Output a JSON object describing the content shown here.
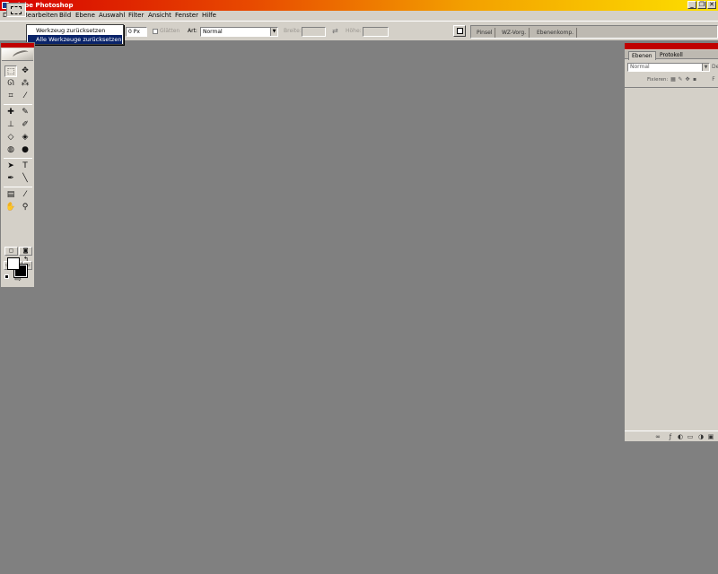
{
  "app": {
    "title": "Adobe Photoshop",
    "window_buttons": [
      "_",
      "❐",
      "✕"
    ]
  },
  "menu": {
    "items": [
      "Datei",
      "Bearbeiten",
      "Bild",
      "Ebene",
      "Auswahl",
      "Filter",
      "Ansicht",
      "Fenster",
      "Hilfe"
    ]
  },
  "options": {
    "feather_value": "0 Px",
    "antialias_label": "Glätten",
    "style_label": "Art:",
    "style_value": "Normal",
    "width_label": "Breite:",
    "height_label": "Höhe:"
  },
  "palette_well": {
    "tabs": [
      "Pinsel",
      "WZ-Vorg.",
      "Ebenenkomp."
    ]
  },
  "dropdown": {
    "items": [
      {
        "label": "Werkzeug zurücksetzen",
        "selected": false
      },
      {
        "label": "Alle Werkzeuge zurücksetzen",
        "selected": true
      }
    ]
  },
  "layers_palette": {
    "tabs": [
      "Ebenen",
      "Protokoll"
    ],
    "blend_mode": "Normal",
    "opacity_stub": "De",
    "lock_label": "Fixieren:",
    "fill_stub": "F"
  },
  "colors": {
    "canvas_bg": "#808080",
    "chrome": "#d4d0c8",
    "palette_header": "#c00000",
    "menu_highlight": "#0a246a",
    "foreground": "#ffffff",
    "background": "#000000"
  }
}
